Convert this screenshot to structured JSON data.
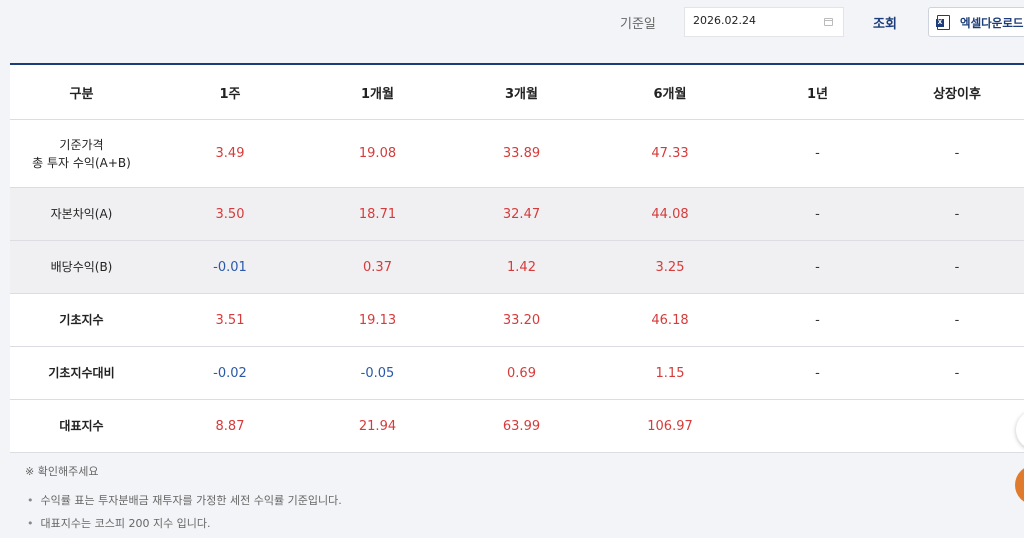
{
  "toolbar": {
    "date_label": "기준일",
    "date_value": "2026.02.24",
    "search_label": "조회",
    "excel_label": "엑셀다운로드",
    "excel_icon": "excel-icon"
  },
  "table": {
    "headers": [
      "구분",
      "1주",
      "1개월",
      "3개월",
      "6개월",
      "1년",
      "상장이후"
    ],
    "rows": [
      {
        "label": "기준가격",
        "sublabel": "총 투자 수익(A+B)",
        "values": [
          "3.49",
          "19.08",
          "33.89",
          "47.33",
          "-",
          "-"
        ]
      },
      {
        "label": "자본차익(A)",
        "values": [
          "3.50",
          "18.71",
          "32.47",
          "44.08",
          "-",
          "-"
        ]
      },
      {
        "label": "배당수익(B)",
        "values": [
          "-0.01",
          "0.37",
          "1.42",
          "3.25",
          "-",
          "-"
        ]
      },
      {
        "label": "기초지수",
        "values": [
          "3.51",
          "19.13",
          "33.20",
          "46.18",
          "-",
          "-"
        ]
      },
      {
        "label": "기초지수대비",
        "values": [
          "-0.02",
          "-0.05",
          "0.69",
          "1.15",
          "-",
          "-"
        ]
      },
      {
        "label": "대표지수",
        "values": [
          "8.87",
          "21.94",
          "63.99",
          "106.97",
          "",
          ""
        ]
      }
    ]
  },
  "notes": {
    "title": "※ 확인해주세요",
    "items": [
      "수익률 표는 투자분배금 재투자를 가정한 세전 수익률 기준입니다.",
      "대표지수는 코스피 200 지수 입니다."
    ]
  },
  "colors": {
    "accent": "#1d3d7a",
    "positive": "#d63b3b",
    "negative": "#2b58a8",
    "floating_button": "#e07a2c"
  }
}
